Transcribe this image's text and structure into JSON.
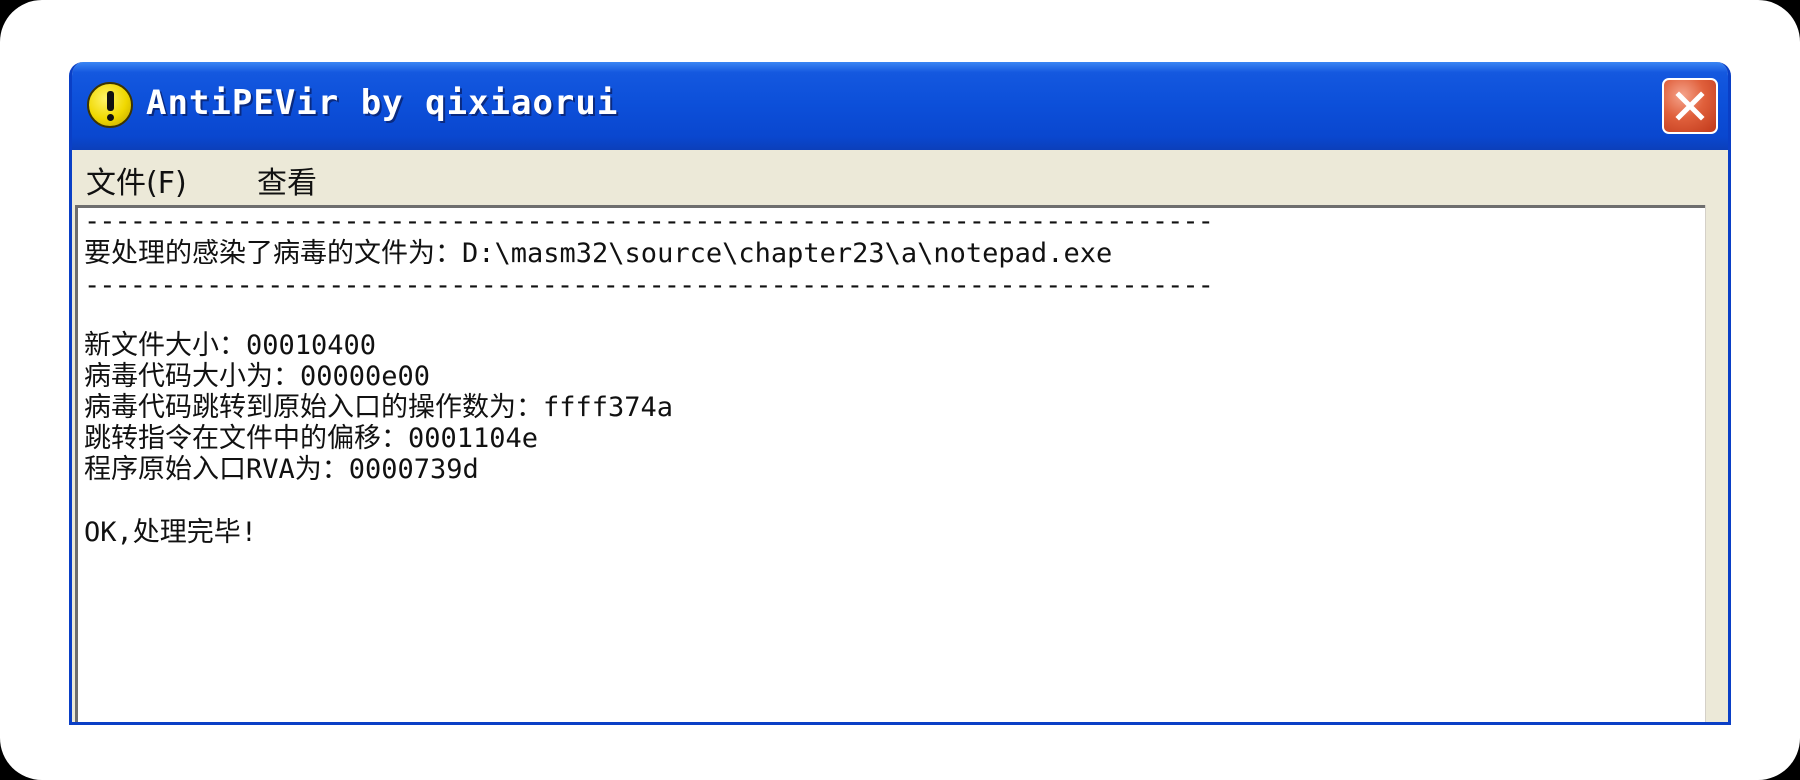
{
  "window": {
    "title": "AntiPEVir by qixiaorui",
    "app_icon": "exclamation-icon",
    "close_icon": "close-icon"
  },
  "menu": {
    "file": "文件(F)",
    "view": "查看"
  },
  "output": {
    "separator": "--------------------------------------------------------------------------",
    "target_line": "要处理的感染了病毒的文件为：D:\\masm32\\source\\chapter23\\a\\notepad.exe",
    "new_file_size": "新文件大小：00010400",
    "virus_code_size": "病毒代码大小为：00000e00",
    "jump_operand": "病毒代码跳转到原始入口的操作数为：ffff374a",
    "jump_offset": "跳转指令在文件中的偏移：0001104e",
    "entry_rva": "程序原始入口RVA为：0000739d",
    "done": "OK,处理完毕!"
  },
  "colors": {
    "titlebar": "#0c4fd9",
    "window_border": "#0a3fc6",
    "close_button": "#e0603c",
    "face": "#ece9d8"
  }
}
